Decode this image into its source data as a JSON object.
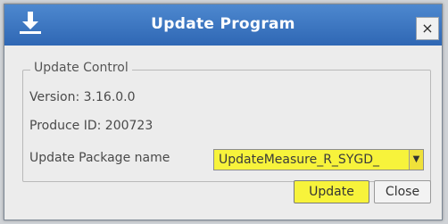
{
  "window": {
    "title": "Update Program",
    "close_label": "×"
  },
  "update_control": {
    "legend": "Update Control",
    "version_label": "Version: 3.16.0.0",
    "produce_id_label": "Produce ID: 200723",
    "package_label": "Update Package name",
    "package_value": "UpdateMeasure_R_SYGD_",
    "dropdown_arrow": "▼"
  },
  "actions": {
    "update_label": "Update",
    "close_label": "Close"
  },
  "colors": {
    "titlebar": "#3f78c2",
    "highlight": "#f7f33b",
    "window": "#ececec"
  },
  "icons": {
    "app": "download-icon",
    "close": "close-icon",
    "dropdown": "chevron-down-icon"
  }
}
